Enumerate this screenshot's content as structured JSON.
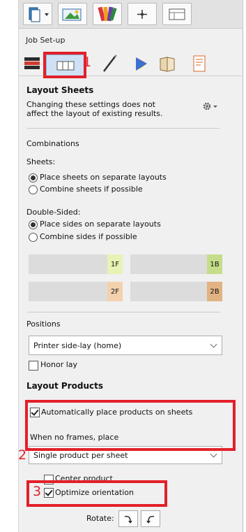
{
  "window": {
    "group_label": "Job Set-up"
  },
  "annotations": [
    "1",
    "2",
    "3"
  ],
  "top_tabs": [
    {
      "icon": "document-dropdown-icon"
    },
    {
      "icon": "image-stack-icon"
    },
    {
      "icon": "color-swatches-icon"
    },
    {
      "icon": "crosshair-icon"
    },
    {
      "icon": "layout-grid-icon"
    }
  ],
  "tool_icons": [
    {
      "icon": "stack-icon"
    },
    {
      "icon": "layout-sheets-icon"
    },
    {
      "icon": "pen-icon"
    },
    {
      "icon": "color-triangle-icon"
    },
    {
      "icon": "book-icon"
    },
    {
      "icon": "page-icon"
    }
  ],
  "layout_sheets": {
    "title": "Layout Sheets",
    "note_line1": "Changing these settings does not",
    "note_line2": "affect the layout of existing results.",
    "gear_icon": "gear-dropdown-icon"
  },
  "combinations": {
    "label": "Combinations",
    "sheets_label": "Sheets:",
    "sheets_options": [
      "Place sheets on separate layouts",
      "Combine sheets if possible"
    ],
    "sheets_selected": 0,
    "double_sided_label": "Double-Sided:",
    "double_options": [
      "Place sides on separate layouts",
      "Combine sides if possible"
    ],
    "double_selected": 0,
    "previews": [
      {
        "label": "1F",
        "color": "#e6f3b4"
      },
      {
        "label": "1B",
        "color": "#c4dd88"
      },
      {
        "label": "2F",
        "color": "#f3d1ad"
      },
      {
        "label": "2B",
        "color": "#e2b382"
      }
    ]
  },
  "positions": {
    "label": "Positions",
    "select_value": "Printer side-lay (home)",
    "honor_lay": "Honor lay",
    "honor_lay_checked": false
  },
  "layout_products": {
    "title": "Layout Products",
    "auto_place": "Automatically place products on sheets",
    "auto_place_checked": true,
    "no_frames_label": "When no frames, place",
    "select_value": "Single product per sheet",
    "center_product": "Center product",
    "center_checked": false,
    "optimize": "Optimize orientation",
    "optimize_checked": true,
    "rotate_label": "Rotate:"
  }
}
